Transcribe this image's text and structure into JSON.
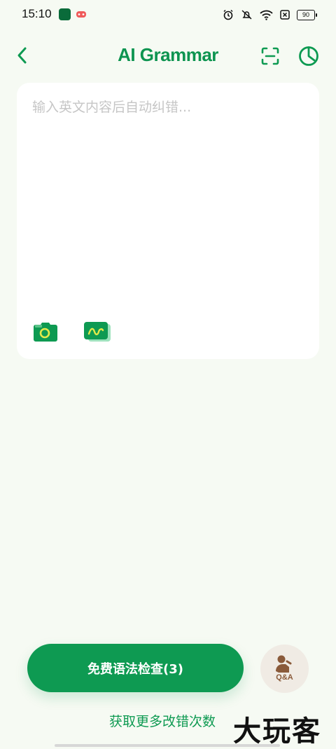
{
  "status_bar": {
    "time": "15:10",
    "battery": "90",
    "icons": [
      "oppo-app-icon",
      "game-icon",
      "alarm-icon",
      "mute-icon",
      "wifi-icon",
      "sim-icon",
      "battery-icon"
    ]
  },
  "header": {
    "title": "AI Grammar",
    "icons": [
      "back-icon",
      "scan-icon",
      "history-icon"
    ]
  },
  "editor": {
    "placeholder": "输入英文内容后自动纠错..."
  },
  "actions": {
    "check_button": "免费语法检查(3)",
    "qa_label": "Q&A",
    "more_link": "获取更多改错次数"
  },
  "watermark": "大玩客",
  "colors": {
    "accent": "#0e9a52",
    "background": "#f6faf3",
    "qa_background": "#f0ebe4",
    "qa_text": "#8a5a3a"
  }
}
